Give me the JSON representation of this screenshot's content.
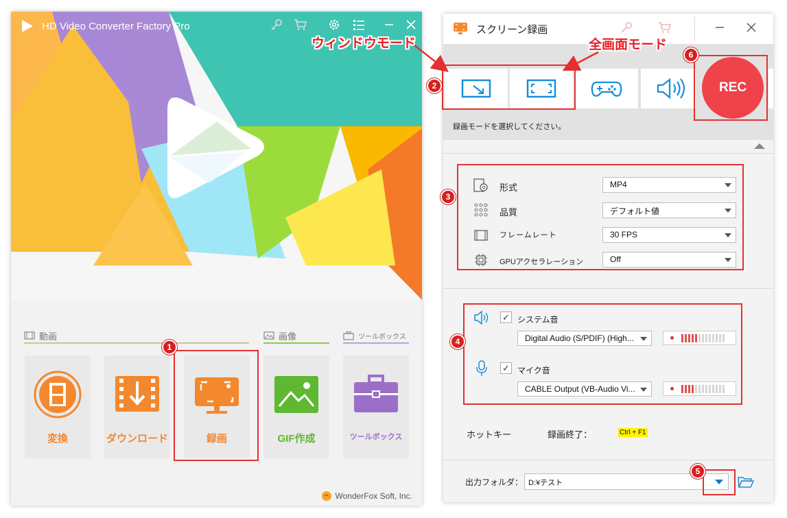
{
  "left_app": {
    "title": "HD Video Converter Factory Pro",
    "categories": [
      {
        "label": "動画",
        "icon": "film-strip-icon"
      },
      {
        "label": "画像",
        "icon": "picture-icon"
      },
      {
        "label": "ツールボックス",
        "icon": "toolbox-small-icon"
      }
    ],
    "tiles": [
      {
        "label": "変換",
        "icon": "convert-film-icon",
        "color": "#f3882e"
      },
      {
        "label": "ダウンロード",
        "icon": "download-icon",
        "color": "#f3882e"
      },
      {
        "label": "録画",
        "icon": "screen-record-icon",
        "color": "#f3882e"
      },
      {
        "label": "GIF作成",
        "icon": "gif-image-icon",
        "color": "#5fb832"
      },
      {
        "label": "ツールボックス",
        "icon": "toolbox-icon",
        "color": "#9b6fc7"
      }
    ],
    "footer": "WonderFox Soft, Inc."
  },
  "recorder": {
    "title": "スクリーン録画",
    "rec_label": "REC",
    "mode_hint": "録画モードを選択してください。",
    "modes": [
      "window-mode-icon",
      "fullscreen-mode-icon",
      "game-mode-icon",
      "audio-only-icon"
    ],
    "settings": [
      {
        "label": "形式",
        "value": "MP4"
      },
      {
        "label": "品質",
        "value": "デフォルト値"
      },
      {
        "label": "フレームレート",
        "value": "30 FPS"
      },
      {
        "label": "GPUアクセラレーション",
        "value": "Off"
      }
    ],
    "audio": [
      {
        "label": "システム音",
        "checked": "✓",
        "device": "Digital Audio (S/PDIF) (High...",
        "level": 0.35
      },
      {
        "label": "マイク音",
        "checked": "✓",
        "device": "CABLE Output (VB-Audio Vi...",
        "level": 0.3
      }
    ],
    "hotkey_label": "ホットキー",
    "hotkey_stop_label": "録画終了：",
    "hotkey_stop_value": "Ctrl + F1",
    "output_label": "出力フォルダ：",
    "output_value": "D:¥テスト"
  },
  "annotations": {
    "window_mode": "ウィンドウモード",
    "fullscreen_mode": "全画面モード",
    "badges": [
      "1",
      "2",
      "3",
      "4",
      "5",
      "6"
    ]
  },
  "colors": {
    "accent_orange": "#f3882e",
    "rec_red": "#f0424a",
    "annotation_red": "#e53030",
    "hotkey_highlight": "#fff200",
    "mode_icon_blue": "#1a8fd8"
  }
}
